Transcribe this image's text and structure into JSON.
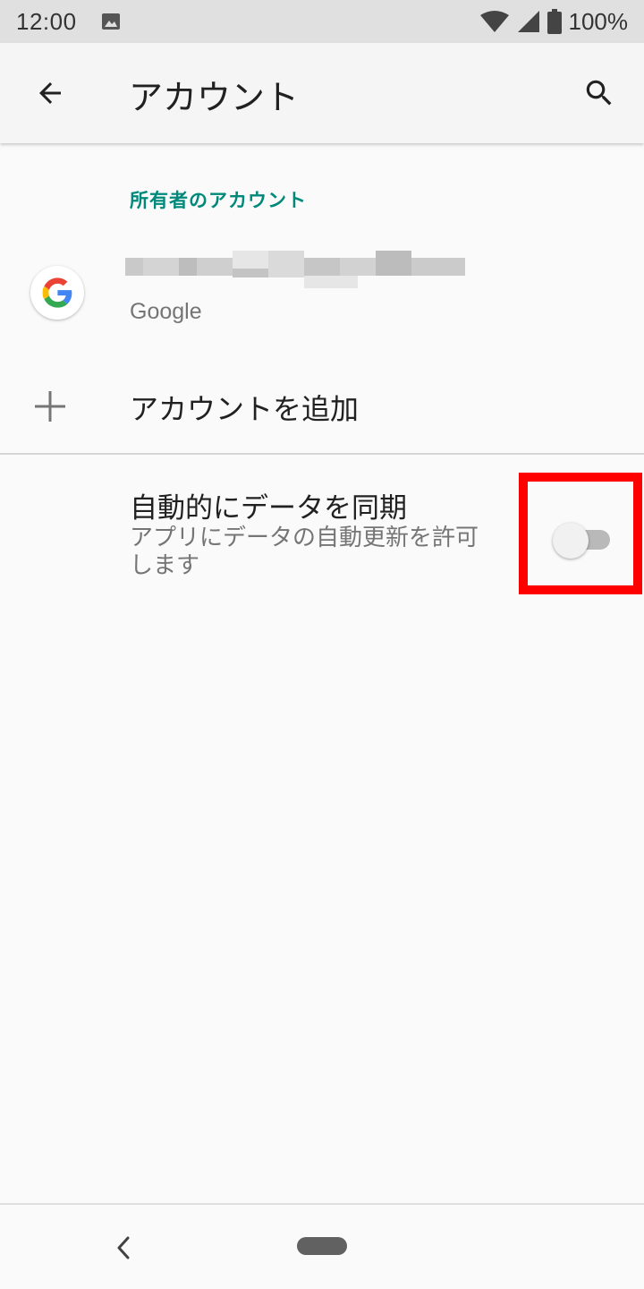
{
  "status_bar": {
    "time": "12:00",
    "battery": "100%",
    "icons": [
      "image-notification-icon",
      "wifi-icon",
      "cell-signal-icon",
      "battery-icon"
    ]
  },
  "app_bar": {
    "title": "アカウント",
    "back_icon": "arrow-back-icon",
    "search_icon": "search-icon"
  },
  "section": {
    "header": "所有者のアカウント"
  },
  "account": {
    "type": "Google",
    "icon": "google-logo-icon"
  },
  "add_account": {
    "label": "アカウントを追加",
    "icon": "plus-icon"
  },
  "sync": {
    "title": "自動的にデータを同期",
    "summary": "アプリにデータの自動更新を許可します",
    "enabled": false
  },
  "colors": {
    "accent": "#00897b",
    "highlight": "#ff0000"
  },
  "nav_bar": {
    "back_icon": "nav-back-icon",
    "home_icon": "nav-home-pill"
  }
}
